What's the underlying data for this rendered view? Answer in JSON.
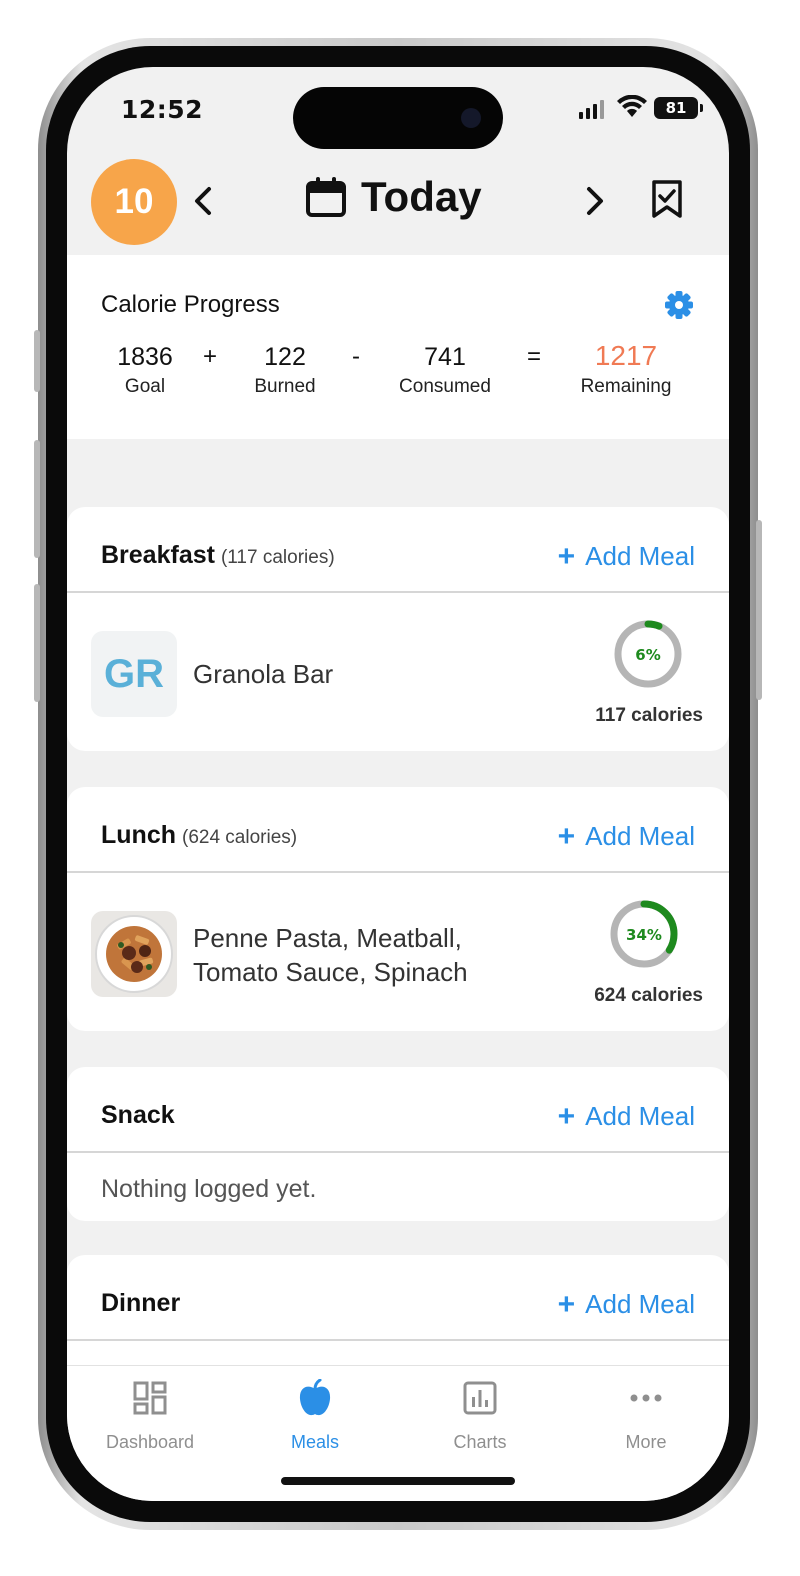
{
  "status_bar": {
    "time": "12:52",
    "battery": "81"
  },
  "header": {
    "streak": "10",
    "title": "Today"
  },
  "calorie_progress": {
    "title": "Calorie Progress",
    "goal": {
      "value": "1836",
      "label": "Goal"
    },
    "op_plus": "+",
    "burned": {
      "value": "122",
      "label": "Burned"
    },
    "op_minus": "-",
    "consumed": {
      "value": "741",
      "label": "Consumed"
    },
    "op_equals": "=",
    "remaining": {
      "value": "1217",
      "label": "Remaining"
    },
    "remaining_color": "#f07a54"
  },
  "add_meal_label": "Add Meal",
  "meals": {
    "breakfast": {
      "name": "Breakfast",
      "calories": "(117 calories)",
      "items": [
        {
          "thumb_text": "GR",
          "name": "Granola Bar",
          "percent": 6,
          "percent_label": "6%",
          "calories": "117 calories"
        }
      ]
    },
    "lunch": {
      "name": "Lunch",
      "calories": "(624 calories)",
      "items": [
        {
          "thumb_icon": "pasta-plate-photo",
          "name_line1": "Penne Pasta, Meatball,",
          "name_line2": "Tomato Sauce, Spinach",
          "percent": 34,
          "percent_label": "34%",
          "calories": "624 calories"
        }
      ]
    },
    "snack": {
      "name": "Snack",
      "empty": "Nothing logged yet."
    },
    "dinner": {
      "name": "Dinner"
    }
  },
  "tabs": [
    {
      "label": "Dashboard",
      "icon": "dashboard-icon",
      "active": false
    },
    {
      "label": "Meals",
      "icon": "apple-icon",
      "active": true
    },
    {
      "label": "Charts",
      "icon": "bar-chart-icon",
      "active": false
    },
    {
      "label": "More",
      "icon": "more-dots-icon",
      "active": false
    }
  ],
  "colors": {
    "accent": "#2b8fe6",
    "streak": "#f7a54a",
    "ring_fill": "#1e8a1e",
    "ring_track": "#b5b5b5"
  }
}
